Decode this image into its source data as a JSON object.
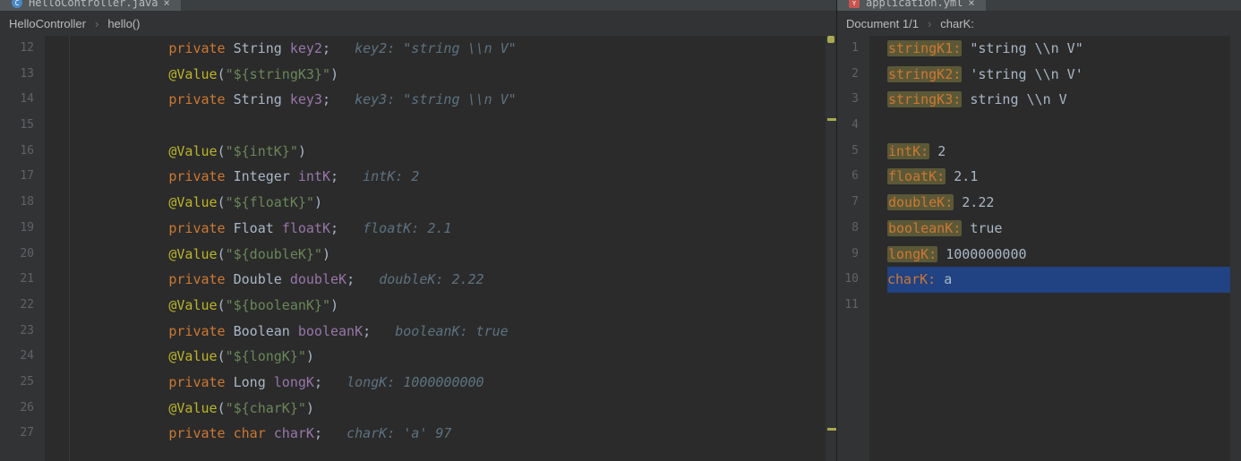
{
  "left": {
    "tab": "HelloController.java",
    "breadcrumb": {
      "p1": "HelloController",
      "p2": "hello()"
    },
    "sep": "›",
    "lines_start": 12,
    "lines_end": 27,
    "code": [
      {
        "indent": 3,
        "t": "field",
        "kw": "private",
        "type": "String",
        "name": "key2",
        "hint": "key2: \"string \\\\n V\""
      },
      {
        "indent": 3,
        "t": "anno",
        "anno": "@Value",
        "expr": "\"${stringK3}\""
      },
      {
        "indent": 3,
        "t": "field",
        "kw": "private",
        "type": "String",
        "name": "key3",
        "hint": "key3: \"string \\\\n V\""
      },
      {
        "indent": 0,
        "t": "blank"
      },
      {
        "indent": 3,
        "t": "anno",
        "anno": "@Value",
        "expr": "\"${intK}\""
      },
      {
        "indent": 3,
        "t": "field",
        "kw": "private",
        "type": "Integer",
        "name": "intK",
        "hint": "intK: 2"
      },
      {
        "indent": 3,
        "t": "anno",
        "anno": "@Value",
        "expr": "\"${floatK}\""
      },
      {
        "indent": 3,
        "t": "field",
        "kw": "private",
        "type": "Float",
        "name": "floatK",
        "hint": "floatK: 2.1"
      },
      {
        "indent": 3,
        "t": "anno",
        "anno": "@Value",
        "expr": "\"${doubleK}\""
      },
      {
        "indent": 3,
        "t": "field",
        "kw": "private",
        "type": "Double",
        "name": "doubleK",
        "hint": "doubleK: 2.22"
      },
      {
        "indent": 3,
        "t": "anno",
        "anno": "@Value",
        "expr": "\"${booleanK}\""
      },
      {
        "indent": 3,
        "t": "field",
        "kw": "private",
        "type": "Boolean",
        "name": "booleanK",
        "hint": "booleanK: true"
      },
      {
        "indent": 3,
        "t": "anno",
        "anno": "@Value",
        "expr": "\"${longK}\""
      },
      {
        "indent": 3,
        "t": "field",
        "kw": "private",
        "type": "Long",
        "name": "longK",
        "hint": "longK: 1000000000"
      },
      {
        "indent": 3,
        "t": "anno",
        "anno": "@Value",
        "expr": "\"${charK}\""
      },
      {
        "indent": 3,
        "t": "field",
        "kw": "private",
        "type": "char",
        "name": "charK",
        "hint": "charK: 'a' 97",
        "typekw": true
      }
    ]
  },
  "right": {
    "tab": "application.yml",
    "breadcrumb": {
      "p1": "Document 1/1",
      "p2": "charK:"
    },
    "sep": "›",
    "lines_start": 1,
    "lines_end": 11,
    "yaml": [
      {
        "key": "stringK1",
        "v": "\"string \\\\n V\"",
        "hl": true
      },
      {
        "key": "stringK2",
        "v": "'string \\\\n V'",
        "hl": true
      },
      {
        "key": "stringK3",
        "v": "string \\\\n V",
        "hl": true
      },
      {
        "blank": true
      },
      {
        "key": "intK",
        "v": "2",
        "hl": true
      },
      {
        "key": "floatK",
        "v": "2.1",
        "hl": true
      },
      {
        "key": "doubleK",
        "v": "2.22",
        "hl": true
      },
      {
        "key": "booleanK",
        "v": "true",
        "hl": true
      },
      {
        "key": "longK",
        "v": "1000000000",
        "hl": true
      },
      {
        "key": "charK",
        "v": "a",
        "selected": true
      },
      {
        "blank": true
      }
    ]
  }
}
